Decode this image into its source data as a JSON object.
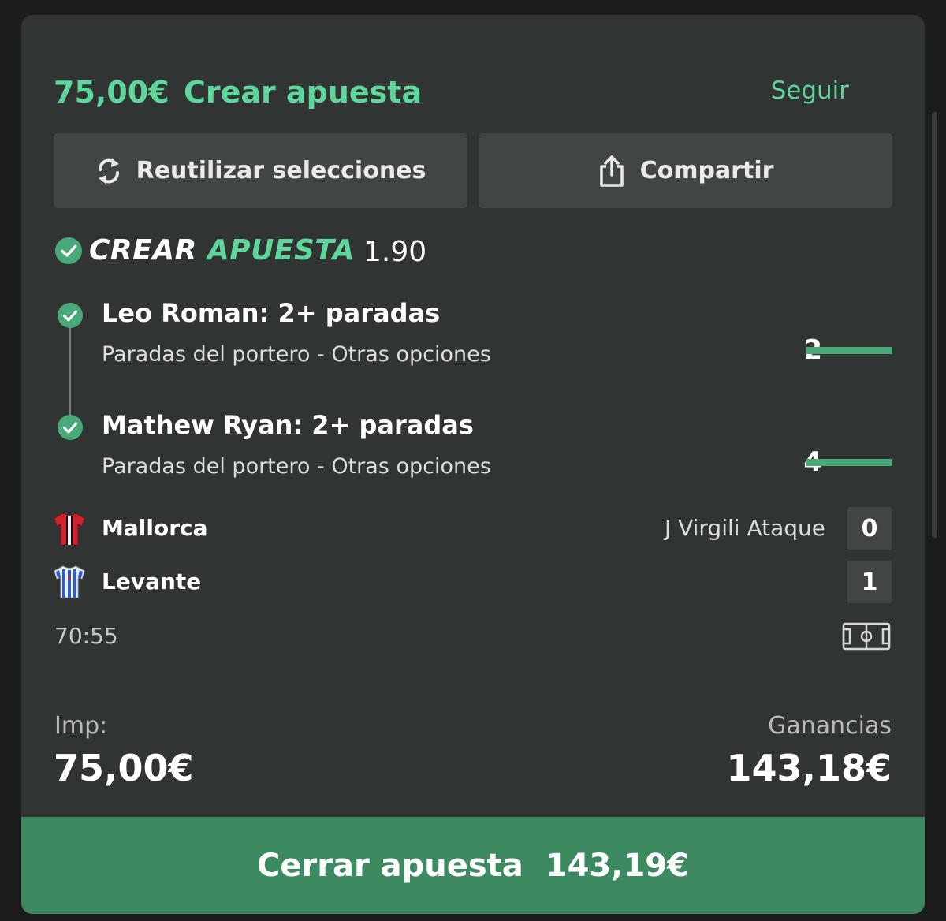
{
  "header": {
    "amount": "75,00€",
    "title": "Crear apuesta",
    "follow_label": "Seguir"
  },
  "actions": {
    "reuse_label": "Reutilizar selecciones",
    "reuse_icon": "refresh-icon",
    "share_label": "Compartir",
    "share_icon": "share-icon"
  },
  "bet_builder": {
    "label_part1": "CREAR",
    "label_part2": "APUESTA",
    "odds": "1.90",
    "icon": "check-circle-icon"
  },
  "selections": [
    {
      "title": "Leo Roman: 2+ paradas",
      "market": "Paradas del portero - Otras opciones",
      "count": "2",
      "progress": 1.0,
      "status": "won"
    },
    {
      "title": "Mathew Ryan: 2+ paradas",
      "market": "Paradas del portero - Otras opciones",
      "count": "4",
      "progress": 1.0,
      "status": "won"
    }
  ],
  "match": {
    "home": {
      "name": "Mallorca",
      "score": "0",
      "icon": "mallorca-shirt-icon"
    },
    "away": {
      "name": "Levante",
      "score": "1",
      "icon": "levante-shirt-icon"
    },
    "incident": "J Virgili Ataque",
    "clock": "70:55",
    "pitch_icon": "pitch-icon"
  },
  "stake": {
    "label": "Imp:",
    "value": "75,00€"
  },
  "returns": {
    "label": "Ganancias",
    "value": "143,18€"
  },
  "cashout": {
    "label": "Cerrar apuesta",
    "value": "143,19€"
  },
  "colors": {
    "accent": "#5fd69b",
    "card_bg": "#303432",
    "button_bg": "#414543",
    "cashout_bg": "#3d8a61",
    "page_bg": "#1c1c1c"
  }
}
